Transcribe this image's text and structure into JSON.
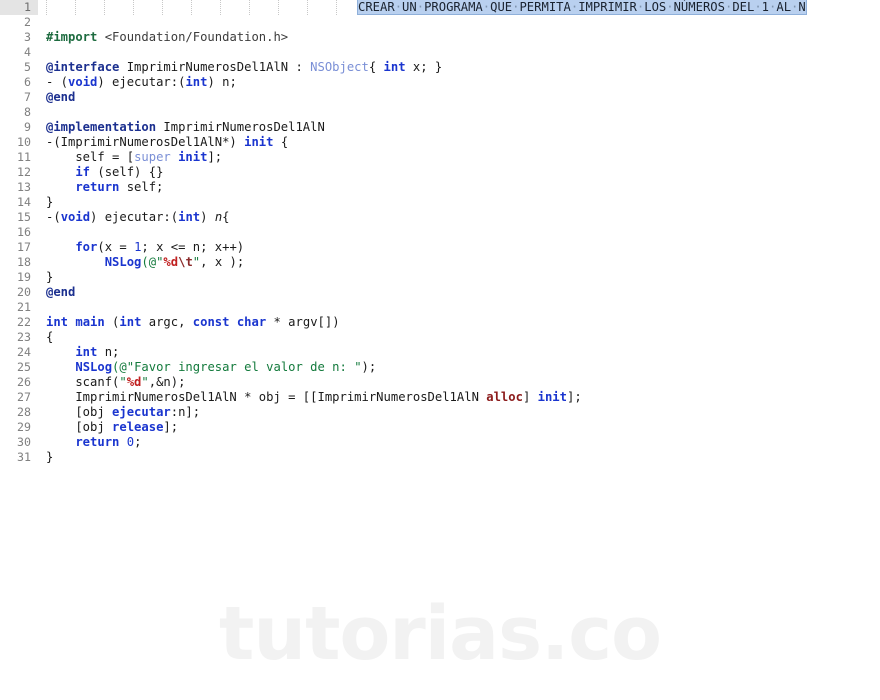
{
  "editor": {
    "language": "Objective-C",
    "total_lines": 31,
    "current_line": 1,
    "gutter_color": "#808080",
    "current_line_bg": "#e4e4e4",
    "selection_bg": "#b9d0ef",
    "background": "#ffffff"
  },
  "watermark": {
    "text": "tutorias.co",
    "color": "#f2f2f2"
  },
  "selection": {
    "text": "CREAR UN PROGRAMA QUE PERMITA IMPRIMIR LOS NÚMEROS DEL 1 AL N",
    "whitespace_marker": "·",
    "caret_visible": "true"
  },
  "line_numbers": [
    "1",
    "2",
    "3",
    "4",
    "5",
    "6",
    "7",
    "8",
    "9",
    "10",
    "11",
    "12",
    "13",
    "14",
    "15",
    "16",
    "17",
    "18",
    "19",
    "20",
    "21",
    "22",
    "23",
    "24",
    "25",
    "26",
    "27",
    "28",
    "29",
    "30",
    "31"
  ],
  "code": {
    "l1_selected": "CREAR·UN·PROGRAMA·QUE·PERMITA·IMPRIMIR·LOS·NÚMEROS·DEL·1·AL·N",
    "l2": "",
    "l3_import": "#import",
    "l3_header": " <Foundation/Foundation.h>",
    "l4": "",
    "l5_at": "@interface",
    "l5_name": " ImprimirNumerosDel1AlN : ",
    "l5_class": "NSObject",
    "l5_brace": "{ ",
    "l5_int": "int",
    "l5_tail": " x; }",
    "l6_a": "- (",
    "l6_void": "void",
    "l6_b": ") ejecutar:(",
    "l6_int": "int",
    "l6_c": ") n;",
    "l7_end": "@end",
    "l8": "",
    "l9_at": "@implementation",
    "l9_name": " ImprimirNumerosDel1AlN",
    "l10_a": "-(ImprimirNumerosDel1AlN*) ",
    "l10_init": "init",
    "l10_b": " {",
    "l11_a": "    self = [",
    "l11_super": "super",
    "l11_sp": " ",
    "l11_init": "init",
    "l11_b": "];",
    "l12_if": "    if",
    "l12_b": " (self) {}",
    "l13_ret": "    return",
    "l13_b": " self;",
    "l14": "}",
    "l15_a": "-(",
    "l15_void": "void",
    "l15_b": ") ejecutar:(",
    "l15_int": "int",
    "l15_c": ") ",
    "l15_param": "n",
    "l15_d": "{",
    "l16": "",
    "l17_for": "    for",
    "l17_a": "(x = ",
    "l17_num": "1",
    "l17_b": "; x <= n; x++)",
    "l18_pad": "        ",
    "l18_nslog": "NSLog",
    "l18_open": "(",
    "l18_str_a": "@\"",
    "l18_fmt": "%d",
    "l18_esc": "\\t",
    "l18_str_b": "\"",
    "l18_tail": ", x );",
    "l19": "}",
    "l20_end": "@end",
    "l21": "",
    "l22_int1": "int",
    "l22_main": " main",
    "l22_a": " (",
    "l22_int2": "int",
    "l22_b": " argc, ",
    "l22_const": "const",
    "l22_sp": " ",
    "l22_char": "char",
    "l22_c": " * argv[])",
    "l23": "{",
    "l24_int": "    int",
    "l24_b": " n;",
    "l25_pad": "    ",
    "l25_nslog": "NSLog",
    "l25_open": "(",
    "l25_str": "@\"Favor ingresar el valor de n: \"",
    "l25_tail": ");",
    "l26_a": "    scanf(",
    "l26_q1": "\"",
    "l26_fmt": "%d",
    "l26_q2": "\"",
    "l26_b": ",&n);",
    "l27_a": "    ImprimirNumerosDel1AlN * obj = [[ImprimirNumerosDel1AlN ",
    "l27_alloc": "alloc",
    "l27_b": "] ",
    "l27_init": "init",
    "l27_c": "];",
    "l28_a": "    [obj ",
    "l28_msg": "ejecutar",
    "l28_b": ":n];",
    "l29_a": "    [obj ",
    "l29_msg": "release",
    "l29_b": "];",
    "l30_ret": "    return",
    "l30_sp": " ",
    "l30_num": "0",
    "l30_b": ";",
    "l31": "}"
  }
}
